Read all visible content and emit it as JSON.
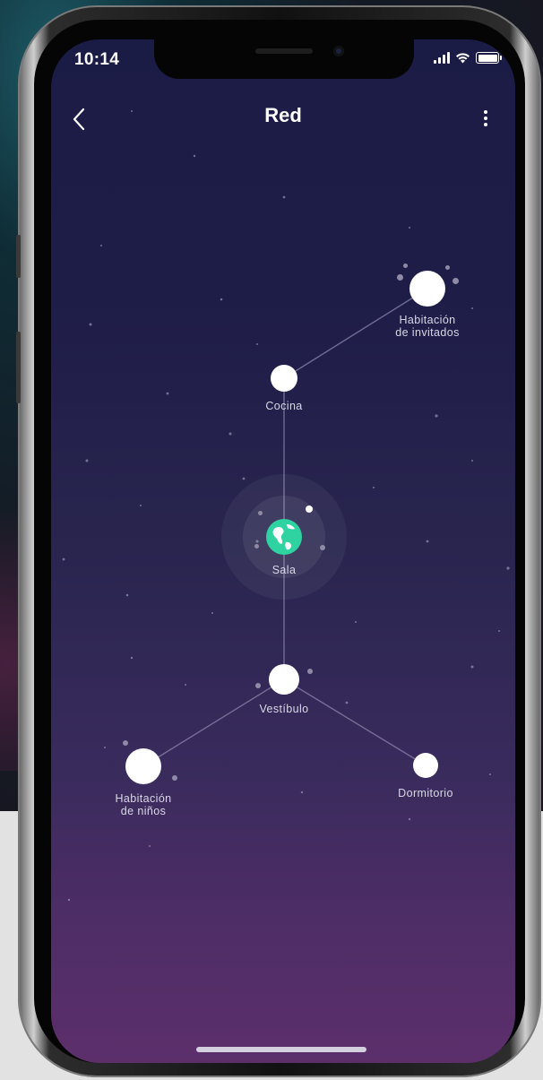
{
  "status_bar": {
    "time": "10:14"
  },
  "header": {
    "title": "Red",
    "back_icon": "chevron-left-icon",
    "menu_icon": "more-vertical-icon"
  },
  "network": {
    "center": {
      "label": "Sala",
      "icon": "globe-icon",
      "color": "#2fd3a2"
    },
    "nodes": [
      {
        "id": "guest",
        "label_line1": "Habitación",
        "label_line2": "de invitados"
      },
      {
        "id": "kitchen",
        "label_line1": "Cocina"
      },
      {
        "id": "hall",
        "label_line1": "Vestíbulo"
      },
      {
        "id": "kids",
        "label_line1": "Habitación",
        "label_line2": "de niños"
      },
      {
        "id": "bedroom",
        "label_line1": "Dormitorio"
      }
    ]
  },
  "colors": {
    "screen_top": "#1b1c45",
    "screen_bottom": "#5c2f6b",
    "node": "#ffffff",
    "center_accent": "#2fd3a2"
  }
}
